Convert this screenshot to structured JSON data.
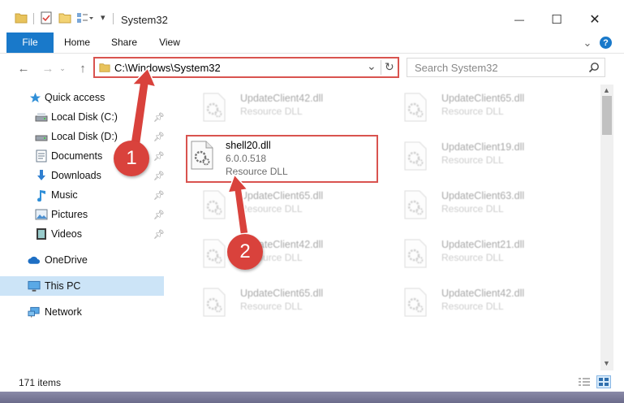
{
  "window": {
    "title": "System32",
    "minimize_glyph": "—",
    "maximize_glyph": "☐",
    "close_glyph": "✕"
  },
  "ribbon": {
    "tabs": [
      "File",
      "Home",
      "Share",
      "View"
    ],
    "expand_glyph": "⌄",
    "help_glyph": "?"
  },
  "navigation": {
    "back_glyph": "←",
    "forward_glyph": "→",
    "up_glyph": "↑",
    "address": "C:\\Windows\\System32",
    "dropdown_glyph": "⌄",
    "refresh_glyph": "↻",
    "search_placeholder": "Search System32"
  },
  "sidebar": {
    "quick_access": "Quick access",
    "pinned": [
      {
        "label": "Local Disk (C:)",
        "icon": "drive-icon"
      },
      {
        "label": "Local Disk (D:)",
        "icon": "drive-icon"
      },
      {
        "label": "Documents",
        "icon": "documents-icon"
      },
      {
        "label": "Downloads",
        "icon": "downloads-icon"
      },
      {
        "label": "Music",
        "icon": "music-icon"
      },
      {
        "label": "Pictures",
        "icon": "pictures-icon"
      },
      {
        "label": "Videos",
        "icon": "videos-icon"
      }
    ],
    "onedrive": "OneDrive",
    "this_pc": "This PC",
    "network": "Network"
  },
  "files": {
    "col1": [
      {
        "name": "UpdateClient42.dll",
        "type": "Resource DLL"
      },
      {
        "name": "shell20.dll",
        "version": "6.0.0.518",
        "type": "Resource DLL"
      },
      {
        "name": "UpdateClient65.dll",
        "type": "Resource DLL"
      },
      {
        "name": "UpdateClient42.dll",
        "type": "Resource DLL"
      },
      {
        "name": "UpdateClient65.dll",
        "type": "Resource DLL"
      }
    ],
    "col2": [
      {
        "name": "UpdateClient65.dll",
        "type": "Resource DLL"
      },
      {
        "name": "UpdateClient19.dll",
        "type": "Resource DLL"
      },
      {
        "name": "UpdateClient63.dll",
        "type": "Resource DLL"
      },
      {
        "name": "UpdateClient21.dll",
        "type": "Resource DLL"
      },
      {
        "name": "UpdateClient42.dll",
        "type": "Resource DLL"
      }
    ]
  },
  "status": {
    "item_count": "171 items"
  },
  "callouts": [
    "1",
    "2"
  ],
  "colors": {
    "accent": "#1979ca",
    "highlight": "#d9534f",
    "selection": "#cce4f7"
  }
}
